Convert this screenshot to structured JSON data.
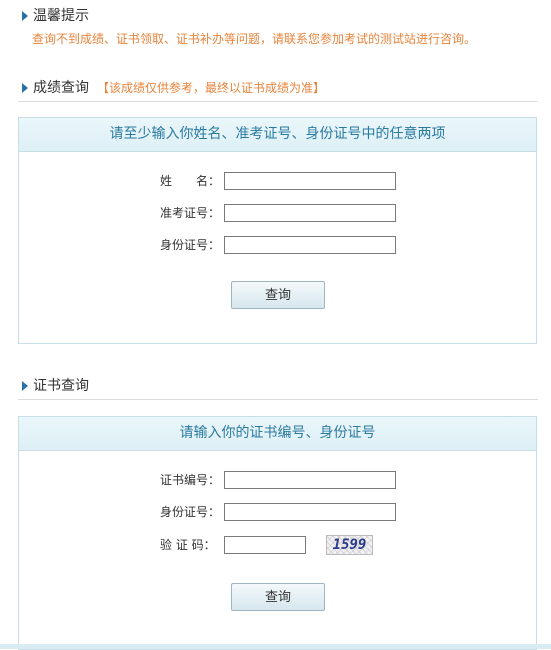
{
  "tip": {
    "title": "温馨提示",
    "text": "查询不到成绩、证书领取、证书补办等问题，请联系您参加考试的测试站进行咨询。"
  },
  "score_section": {
    "title": "成绩查询",
    "note": "【该成绩仅供参考，最终以证书成绩为准】",
    "panel_header": "请至少输入你姓名、准考证号、身份证号中的任意两项",
    "name_label": "姓　　名：",
    "exam_no_label": "准考证号：",
    "id_label": "身份证号：",
    "name_value": "",
    "exam_no_value": "",
    "id_value": "",
    "query_button": "查询"
  },
  "cert_section": {
    "title": "证书查询",
    "panel_header": "请输入你的证书编号、身份证号",
    "cert_no_label": "证书编号：",
    "id_label": "身份证号：",
    "captcha_label": "验 证 码：",
    "cert_no_value": "",
    "id_value": "",
    "captcha_value": "",
    "captcha_image_text": "1599",
    "query_button": "查询"
  },
  "colors": {
    "accent_orange": "#e8843c",
    "header_blue": "#2a7aa0",
    "triangle_blue": "#2a6fa8"
  },
  "icons": [
    "triangle-bullet-icon"
  ]
}
